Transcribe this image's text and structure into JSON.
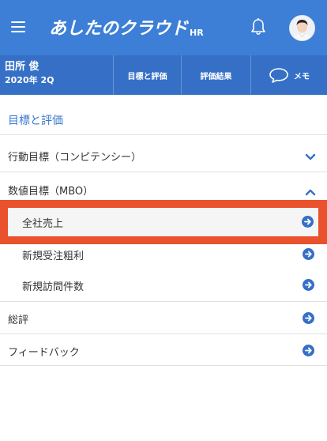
{
  "header": {
    "logo_text": "あしたのクラウド",
    "logo_sub": "HR",
    "icons": {
      "menu": "hamburger-menu-icon",
      "bell": "bell-icon",
      "avatar": "user-avatar"
    },
    "colors": {
      "primary": "#3d7fd6",
      "secondary": "#3570c6",
      "highlight": "#e9522d"
    }
  },
  "subheader": {
    "user_name": "田所 俊",
    "period": "2020年 2Q",
    "tabs": [
      {
        "label": "目標と評価"
      },
      {
        "label": "評価結果"
      },
      {
        "label": "メモ",
        "icon": "speech-bubble-icon"
      }
    ]
  },
  "main": {
    "section_title": "目標と評価",
    "items": [
      {
        "label": "行動目標（コンピテンシー）",
        "icon": "chevron-down-icon"
      },
      {
        "label": "数値目標（MBO）",
        "icon": "chevron-up-icon"
      },
      {
        "label": "全社売上",
        "icon": "arrow-right-circle-icon"
      },
      {
        "label": "新規受注粗利",
        "icon": "arrow-right-circle-icon"
      },
      {
        "label": "新規訪問件数",
        "icon": "arrow-right-circle-icon"
      },
      {
        "label": "総評",
        "icon": "arrow-right-circle-icon"
      },
      {
        "label": "フィードバック",
        "icon": "arrow-right-circle-icon"
      }
    ]
  }
}
